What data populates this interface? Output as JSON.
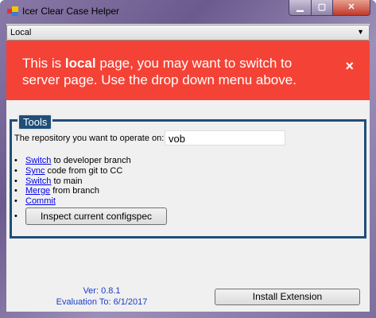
{
  "window": {
    "title": "Icer Clear Case Helper",
    "minimize": "▁",
    "maximize": "▢",
    "close": "✕"
  },
  "mode_select": {
    "value": "Local"
  },
  "banner": {
    "pre": "This is ",
    "bold": "local",
    "post": " page, you may want to switch to server page. Use the drop down menu above.",
    "close": "×",
    "color": "#f44336"
  },
  "tools": {
    "legend": "Tools",
    "repo_label": "The repository you want to operate on:",
    "repo_value": "vob",
    "items": [
      {
        "link": "Switch",
        "text": " to developer branch"
      },
      {
        "link": "Sync",
        "text": " code from git to CC"
      },
      {
        "link": "Switch",
        "text": " to main"
      },
      {
        "link": "Merge",
        "text": " from branch"
      },
      {
        "link": "Commit",
        "text": ""
      }
    ],
    "inspect_button": "Inspect current configspec"
  },
  "footer": {
    "version": "Ver: 0.8.1",
    "evaluation": "Evaluation To: 6/1/2017",
    "install_button": "Install Extension"
  }
}
